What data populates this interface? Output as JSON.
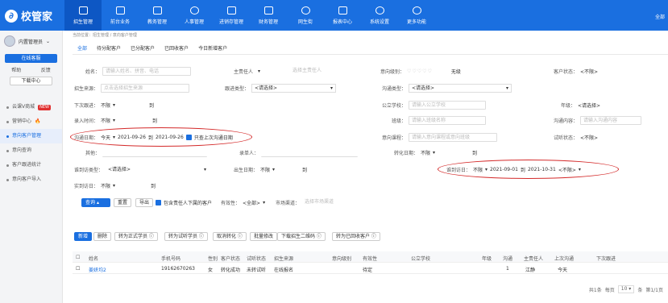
{
  "app": {
    "logo": "校管家",
    "user_short": "全部"
  },
  "nav": [
    {
      "label": "招生管理",
      "active": true
    },
    {
      "label": "前台业务"
    },
    {
      "label": "教务管理"
    },
    {
      "label": "人事管理"
    },
    {
      "label": "进销存管理"
    },
    {
      "label": "财务管理"
    },
    {
      "label": "网生街"
    },
    {
      "label": "报表中心"
    },
    {
      "label": "系统设置"
    },
    {
      "label": "更多功能"
    }
  ],
  "sidebar": {
    "user": "内置管理员",
    "online": "在线客服",
    "help": "帮助",
    "feedback": "反馈",
    "download": "下载中心",
    "items": [
      {
        "label": "云课V商城",
        "badge": "NEW"
      },
      {
        "label": "营销中心",
        "fire": "🔥"
      },
      {
        "label": "意向客户管理",
        "active": true
      },
      {
        "label": "意向查询"
      },
      {
        "label": "客户跟进统计"
      },
      {
        "label": "意向客户导入"
      }
    ]
  },
  "breadcrumb": "当前位置：招生管理 / 意向客户管理",
  "tabs": [
    "全部",
    "待分配客户",
    "已分配客户",
    "已回收客户",
    "今日新增客户"
  ],
  "filters": {
    "name_label": "姓名：",
    "name_ph": "请输入姓名、拼音、电话",
    "owner_label": "主责任人",
    "owner_ph": "选择主责任人",
    "level_label": "意向级别：",
    "level_hearts": "♡♡♡♡♡",
    "level_none": "无级",
    "status_label": "客户状态：",
    "status_val": "<不限>",
    "source_label": "招生来源：",
    "source_ph": "点击选择招生来源",
    "ftype_label": "跟进类型：",
    "ftype_val": "<请选择>",
    "ctype_label": "沟通类型：",
    "ctype_val": "<请选择>",
    "next_label": "下次跟进：",
    "next_val": "不限",
    "to": "到",
    "school_label": "公立学校：",
    "school_ph": "请输入公立学校",
    "grade_label": "年级：",
    "grade_val": "<请选择>",
    "entry_label": "录入时间：",
    "entry_val": "不限",
    "class_label": "班级：",
    "class_ph": "请输入班级名称",
    "content_label": "沟通内容：",
    "content_ph": "请输入沟通内容",
    "cdate_label": "沟通日期：",
    "cdate_val": "今天",
    "cdate_from": "2021-09-26",
    "cdate_to": "2021-09-26",
    "cdate_chk": "只查上次沟通日期",
    "course_label": "意向课程：",
    "course_ph": "请输入意向课程或意向班级",
    "trial_label": "试听状态：",
    "trial_val": "<不限>",
    "other_label": "其他：",
    "entrant_label": "录单人：",
    "convert_label": "转化日期：",
    "convert_val": "不限",
    "vtype_label": "谁到访类型：",
    "vtype_val": "<请选择>",
    "birth_label": "出生日期：",
    "birth_val": "不限",
    "visit_label": "谁到访日：",
    "visit_val": "不限",
    "visit_from": "2021-09-01",
    "visit_to": "2021-10-31",
    "visit_st": "<不限>",
    "actual_label": "实到访日：",
    "actual_val": "不限"
  },
  "actions": {
    "query": "查询",
    "reset": "重置",
    "export": "导出",
    "include": "包含责任人下属的客户",
    "valid_label": "有效性：",
    "valid_val": "<全部>",
    "market_label": "市场渠道：",
    "market_ph": "选择市场渠道"
  },
  "toolbar": [
    "新增",
    "删除",
    "转为正式学员 ⓘ",
    "转为试听学员 ⓘ",
    "取消转化 ⓘ",
    "批量修改",
    "下载招生二维码 ⓘ",
    "转为已回收客户 ⓘ"
  ],
  "table": {
    "headers": [
      "姓名",
      "手机号码",
      "性别",
      "客户状态",
      "试听状态",
      "招生来源",
      "意向级别",
      "有效性",
      "公立学校",
      "年级",
      "沟通",
      "主责任人",
      "上次沟通",
      "下次跟进"
    ],
    "rows": [
      {
        "name": "姜妍均2",
        "phone": "19162670263",
        "gender": "女",
        "status": "转化成功",
        "trial": "未转试听",
        "source": "在线报名",
        "validity": "待定",
        "comm": "1",
        "owner": "江静",
        "last": "今天",
        "next": ""
      }
    ]
  },
  "pager": {
    "total": "共1条",
    "per_label": "每页",
    "per": "10",
    "unit": "条",
    "page": "第1/1页"
  }
}
